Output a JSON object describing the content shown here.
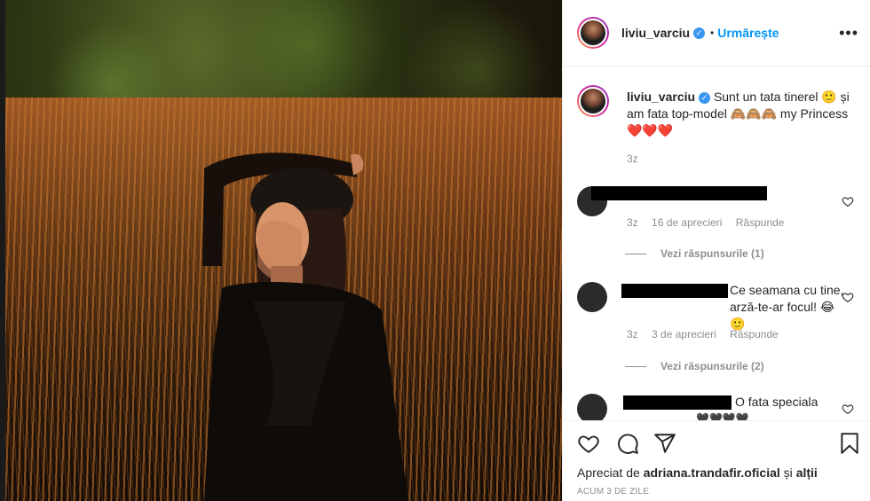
{
  "post": {
    "username": "liviu_varciu",
    "verified_mark": "✓",
    "dot": "•",
    "follow_label": "Urmărește",
    "more_label": "•••"
  },
  "caption": {
    "username": "liviu_varciu",
    "text": "Sunt un tata tinerel 🙂 și am fata top-model 🙈🙈🙈 my Princess ❤️❤️❤️",
    "time": "3z"
  },
  "comments": [
    {
      "text": "",
      "time": "3z",
      "likes": "16 de aprecieri",
      "reply": "Răspunde",
      "view_replies": "Vezi răspunsurile (1)"
    },
    {
      "text": "Ce seamana cu tine, arză-te-ar focul! 😂🙂",
      "time": "3z",
      "likes": "3 de aprecieri",
      "reply": "Răspunde",
      "view_replies": "Vezi răspunsurile (2)"
    },
    {
      "text": "O fata speciala",
      "extra": "🖤🖤🖤🖤"
    }
  ],
  "footer": {
    "liked_prefix": "Apreciat de",
    "liked_user": "adriana.trandafir.oficial",
    "liked_joiner": "și",
    "liked_others": "alții",
    "ago": "ACUM 3 DE ZILE"
  },
  "icons": [
    "ellipsis-icon",
    "verified-badge-icon",
    "heart-icon",
    "comment-icon",
    "share-icon",
    "bookmark-icon"
  ],
  "colors": {
    "accent": "#0095f6",
    "verified": "#3897f0",
    "muted": "#8e8e8e",
    "text": "#262626"
  }
}
